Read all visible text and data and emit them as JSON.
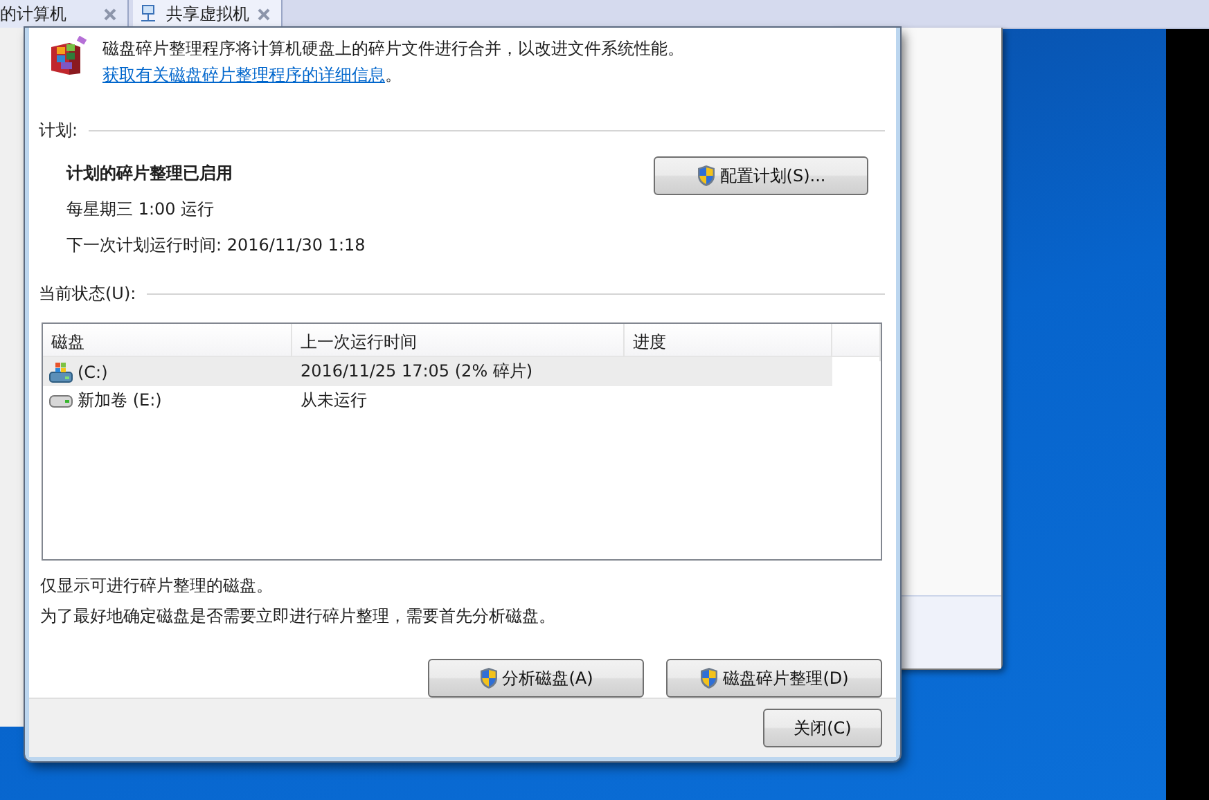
{
  "host_tabs": [
    {
      "label": "的计算机",
      "icon": false,
      "selected": false
    },
    {
      "label": "共享虚拟机",
      "icon": true,
      "selected": true
    }
  ],
  "dialog": {
    "intro": "磁盘碎片整理程序将计算机硬盘上的碎片文件进行合并，以改进文件系统性能。",
    "intro_link": "获取有关磁盘碎片整理程序的详细信息",
    "intro_tail": "。",
    "schedule": {
      "heading": "计划:",
      "status": "计划的碎片整理已启用",
      "frequency": "每星期三  1:00 运行",
      "next_run": "下一次计划运行时间: 2016/11/30 1:18",
      "button": "配置计划(S)..."
    },
    "current_status": {
      "heading": "当前状态(U):",
      "table": {
        "columns": [
          "磁盘",
          "上一次运行时间",
          "进度"
        ],
        "rows": [
          {
            "kind": "system",
            "disk": "(C:)",
            "last_run": "2016/11/25 17:05 (2% 碎片)",
            "selected": true
          },
          {
            "kind": "volume",
            "disk": "新加卷 (E:)",
            "last_run": "从未运行",
            "selected": false
          }
        ]
      }
    },
    "notes": [
      "仅显示可进行碎片整理的磁盘。",
      "为了最好地确定磁盘是否需要立即进行碎片整理，需要首先分析磁盘。"
    ],
    "actions": [
      "分析磁盘(A)",
      "磁盘碎片整理(D)"
    ],
    "close_button": "关闭(C)"
  }
}
